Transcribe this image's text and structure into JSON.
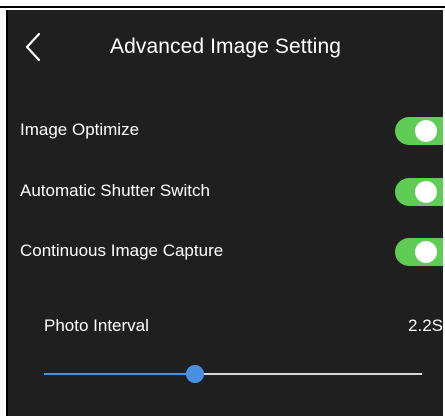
{
  "header": {
    "title": "Advanced Image Setting",
    "back_icon": "chevron-left-icon"
  },
  "settings": [
    {
      "label": "Image Optimize",
      "enabled": true
    },
    {
      "label": "Automatic Shutter Switch",
      "enabled": true
    },
    {
      "label": "Continuous Image Capture",
      "enabled": true
    }
  ],
  "photo_interval": {
    "label": "Photo Interval",
    "value": "2.2S",
    "slider_fraction": 0.4
  },
  "colors": {
    "background": "#1f1f1f",
    "toggle_on": "#5fcc55",
    "slider_accent": "#4a90e2",
    "slider_track": "#d8d8d8",
    "text": "#ffffff"
  }
}
